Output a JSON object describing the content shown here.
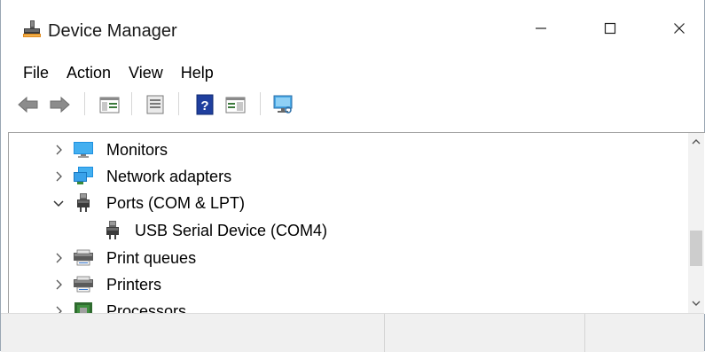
{
  "window": {
    "title": "Device Manager",
    "minimize_glyph": "—",
    "maximize_glyph": "☐",
    "close_glyph": "✕"
  },
  "menu": {
    "items": [
      {
        "label": "File"
      },
      {
        "label": "Action"
      },
      {
        "label": "View"
      },
      {
        "label": "Help"
      }
    ]
  },
  "toolbar": {
    "buttons": [
      "back-arrow-icon",
      "forward-arrow-icon",
      "show-hide-console-tree-icon",
      "properties-icon",
      "help-icon",
      "action-pane-icon",
      "scan-hardware-icon"
    ]
  },
  "tree": {
    "nodes": [
      {
        "label": "Monitors",
        "expander": "collapsed",
        "icon": "monitor-icon"
      },
      {
        "label": "Network adapters",
        "expander": "collapsed",
        "icon": "network-adapter-icon"
      },
      {
        "label": "Ports (COM & LPT)",
        "expander": "expanded",
        "icon": "port-connector-icon"
      },
      {
        "label": "USB Serial Device (COM4)",
        "expander": "none",
        "icon": "port-connector-icon"
      },
      {
        "label": "Print queues",
        "expander": "collapsed",
        "icon": "printer-icon"
      },
      {
        "label": "Printers",
        "expander": "collapsed",
        "icon": "printer-icon"
      },
      {
        "label": "Processors",
        "expander": "collapsed",
        "icon": "processor-chip-icon"
      }
    ]
  },
  "colors": {
    "accent_blue": "#1e90e0",
    "tree_border": "#a0a0a0",
    "statusbar_bg": "#f0f0f0"
  }
}
